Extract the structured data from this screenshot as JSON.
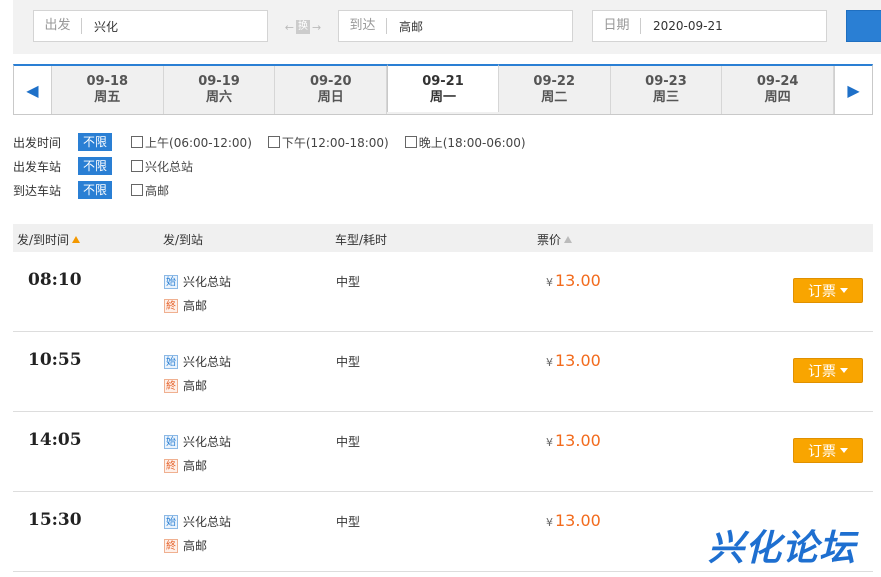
{
  "search": {
    "from_label": "出发",
    "from_value": "兴化",
    "swap_label": "换",
    "to_label": "到达",
    "to_value": "高邮",
    "date_label": "日期",
    "date_value": "2020-09-21"
  },
  "dates": [
    {
      "date": "09-18",
      "weekday": "周五"
    },
    {
      "date": "09-19",
      "weekday": "周六"
    },
    {
      "date": "09-20",
      "weekday": "周日"
    },
    {
      "date": "09-21",
      "weekday": "周一"
    },
    {
      "date": "09-22",
      "weekday": "周二"
    },
    {
      "date": "09-23",
      "weekday": "周三"
    },
    {
      "date": "09-24",
      "weekday": "周四"
    }
  ],
  "filters": {
    "depart_time": {
      "label": "出发时间",
      "all": "不限",
      "options": [
        "上午(06:00-12:00)",
        "下午(12:00-18:00)",
        "晚上(18:00-06:00)"
      ]
    },
    "depart_station": {
      "label": "出发车站",
      "all": "不限",
      "options": [
        "兴化总站"
      ]
    },
    "arrive_station": {
      "label": "到达车站",
      "all": "不限",
      "options": [
        "高邮"
      ]
    }
  },
  "table": {
    "headers": {
      "time": "发/到时间",
      "station": "发/到站",
      "type": "车型/耗时",
      "price": "票价"
    },
    "rows": [
      {
        "time": "08:10",
        "start_badge": "始",
        "from": "兴化总站",
        "end_badge": "終",
        "to": "高邮",
        "type": "中型",
        "currency": "¥",
        "price": "13.00",
        "book": "订票"
      },
      {
        "time": "10:55",
        "start_badge": "始",
        "from": "兴化总站",
        "end_badge": "終",
        "to": "高邮",
        "type": "中型",
        "currency": "¥",
        "price": "13.00",
        "book": "订票"
      },
      {
        "time": "14:05",
        "start_badge": "始",
        "from": "兴化总站",
        "end_badge": "終",
        "to": "高邮",
        "type": "中型",
        "currency": "¥",
        "price": "13.00",
        "book": "订票"
      },
      {
        "time": "15:30",
        "start_badge": "始",
        "from": "兴化总站",
        "end_badge": "終",
        "to": "高邮",
        "type": "中型",
        "currency": "¥",
        "price": "13.00",
        "book": ""
      }
    ]
  },
  "watermark": "兴化论坛",
  "colors": {
    "accent": "#2a7fd4",
    "price": "#f26b1d",
    "book_button": "#f9a500"
  }
}
